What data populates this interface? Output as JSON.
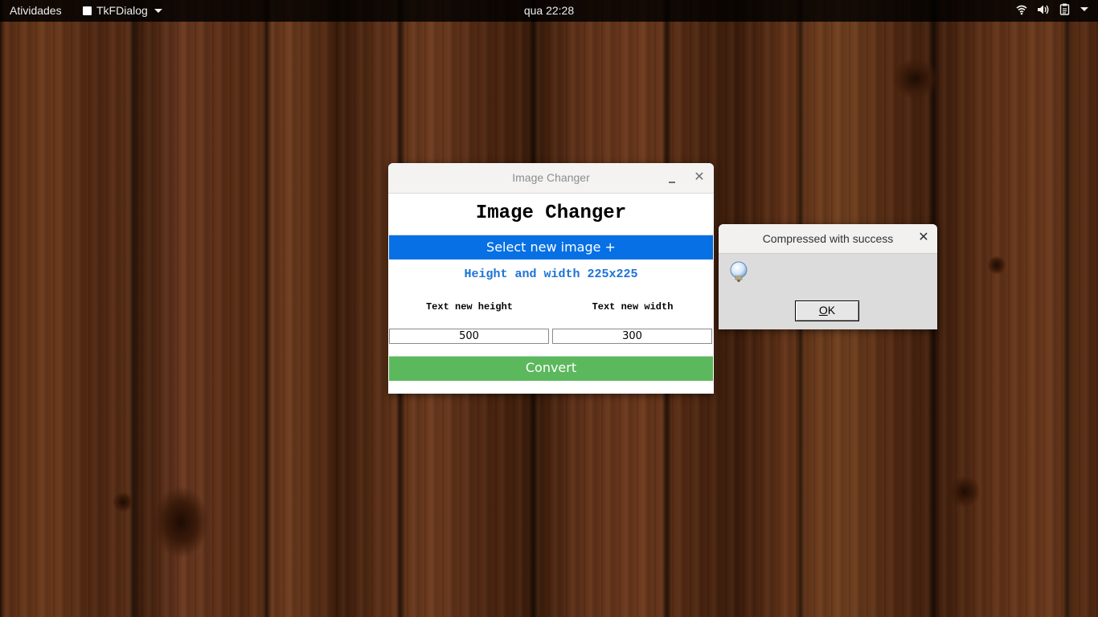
{
  "topbar": {
    "activities": "Atividades",
    "app_name": "TkFDialog",
    "clock": "qua 22:28",
    "icons": [
      "wifi-icon",
      "volume-icon",
      "clipboard-icon"
    ]
  },
  "main_window": {
    "title": "Image Changer",
    "heading": "Image Changer",
    "select_button": "Select new image +",
    "dimensions": "Height and width 225x225",
    "height_label": "Text new height",
    "width_label": "Text new width",
    "height_value": "500",
    "width_value": "300",
    "convert_button": "Convert",
    "colors": {
      "select_button": "#0670e4",
      "convert_button": "#5cb85c",
      "dimensions_text": "#1c73d8"
    }
  },
  "dialog": {
    "title": "Compressed with success",
    "icon": "lightbulb-info-icon",
    "ok_mnemonic": "O",
    "ok_rest": "K"
  }
}
